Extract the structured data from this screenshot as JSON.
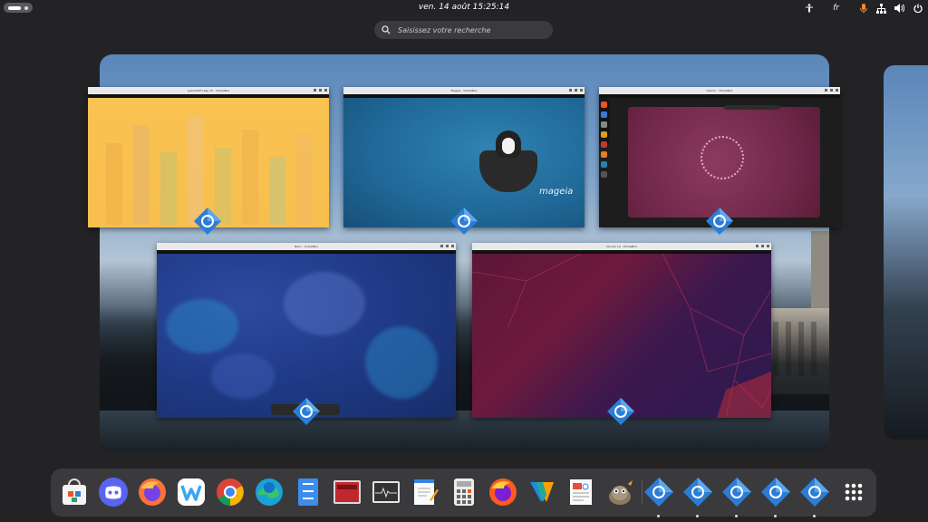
{
  "topbar": {
    "clock": "ven. 14 août  15:25:14",
    "keyboard_layout": "fr",
    "tray_icons": [
      "accessibility-icon",
      "microphone-icon",
      "network-icon",
      "volume-icon",
      "power-icon"
    ]
  },
  "search": {
    "placeholder": "Saisissez votre recherche"
  },
  "windows": [
    {
      "name": "Fedora VirtualBox window",
      "title": "openSUSE Leap 15 · VirtualBox",
      "app_icon": "virtualbox-icon",
      "wallpaper": "yellow-crystals"
    },
    {
      "name": "Mageia VirtualBox window",
      "title": "Mageia · VirtualBox",
      "app_icon": "virtualbox-icon",
      "wallpaper": "mageia-cauldron",
      "logo": "mageia"
    },
    {
      "name": "Ubuntu VirtualBox window",
      "title": "Ubuntu · VirtualBox",
      "app_icon": "virtualbox-icon",
      "wallpaper": "ubuntu-purple"
    },
    {
      "name": "KDE VirtualBox window",
      "title": "Neon · VirtualBox",
      "app_icon": "virtualbox-icon",
      "wallpaper": "kde-blue"
    },
    {
      "name": "Ubuntu 19 VirtualBox window",
      "title": "Ubuntu 19 · VirtualBox",
      "app_icon": "virtualbox-icon",
      "wallpaper": "ubuntu-red-purple"
    }
  ],
  "dock": {
    "apps": [
      {
        "name": "software-store",
        "running": false
      },
      {
        "name": "discord",
        "running": false
      },
      {
        "name": "firefox",
        "running": false
      },
      {
        "name": "wavebox",
        "running": false
      },
      {
        "name": "chrome",
        "running": false
      },
      {
        "name": "edge",
        "running": false
      },
      {
        "name": "file-manager",
        "running": false
      },
      {
        "name": "terminal-red",
        "running": false
      },
      {
        "name": "system-monitor",
        "running": false
      },
      {
        "name": "text-editor",
        "running": false
      },
      {
        "name": "calculator",
        "running": false
      },
      {
        "name": "firefox-dev",
        "running": false
      },
      {
        "name": "vscode-like",
        "running": false
      },
      {
        "name": "document-viewer",
        "running": false
      },
      {
        "name": "gimp",
        "running": false
      },
      {
        "name": "virtualbox",
        "running": true
      },
      {
        "name": "virtualbox",
        "running": true
      },
      {
        "name": "virtualbox",
        "running": true
      },
      {
        "name": "virtualbox",
        "running": true
      },
      {
        "name": "virtualbox",
        "running": true
      }
    ],
    "grid_icon": "show-apps-icon"
  }
}
